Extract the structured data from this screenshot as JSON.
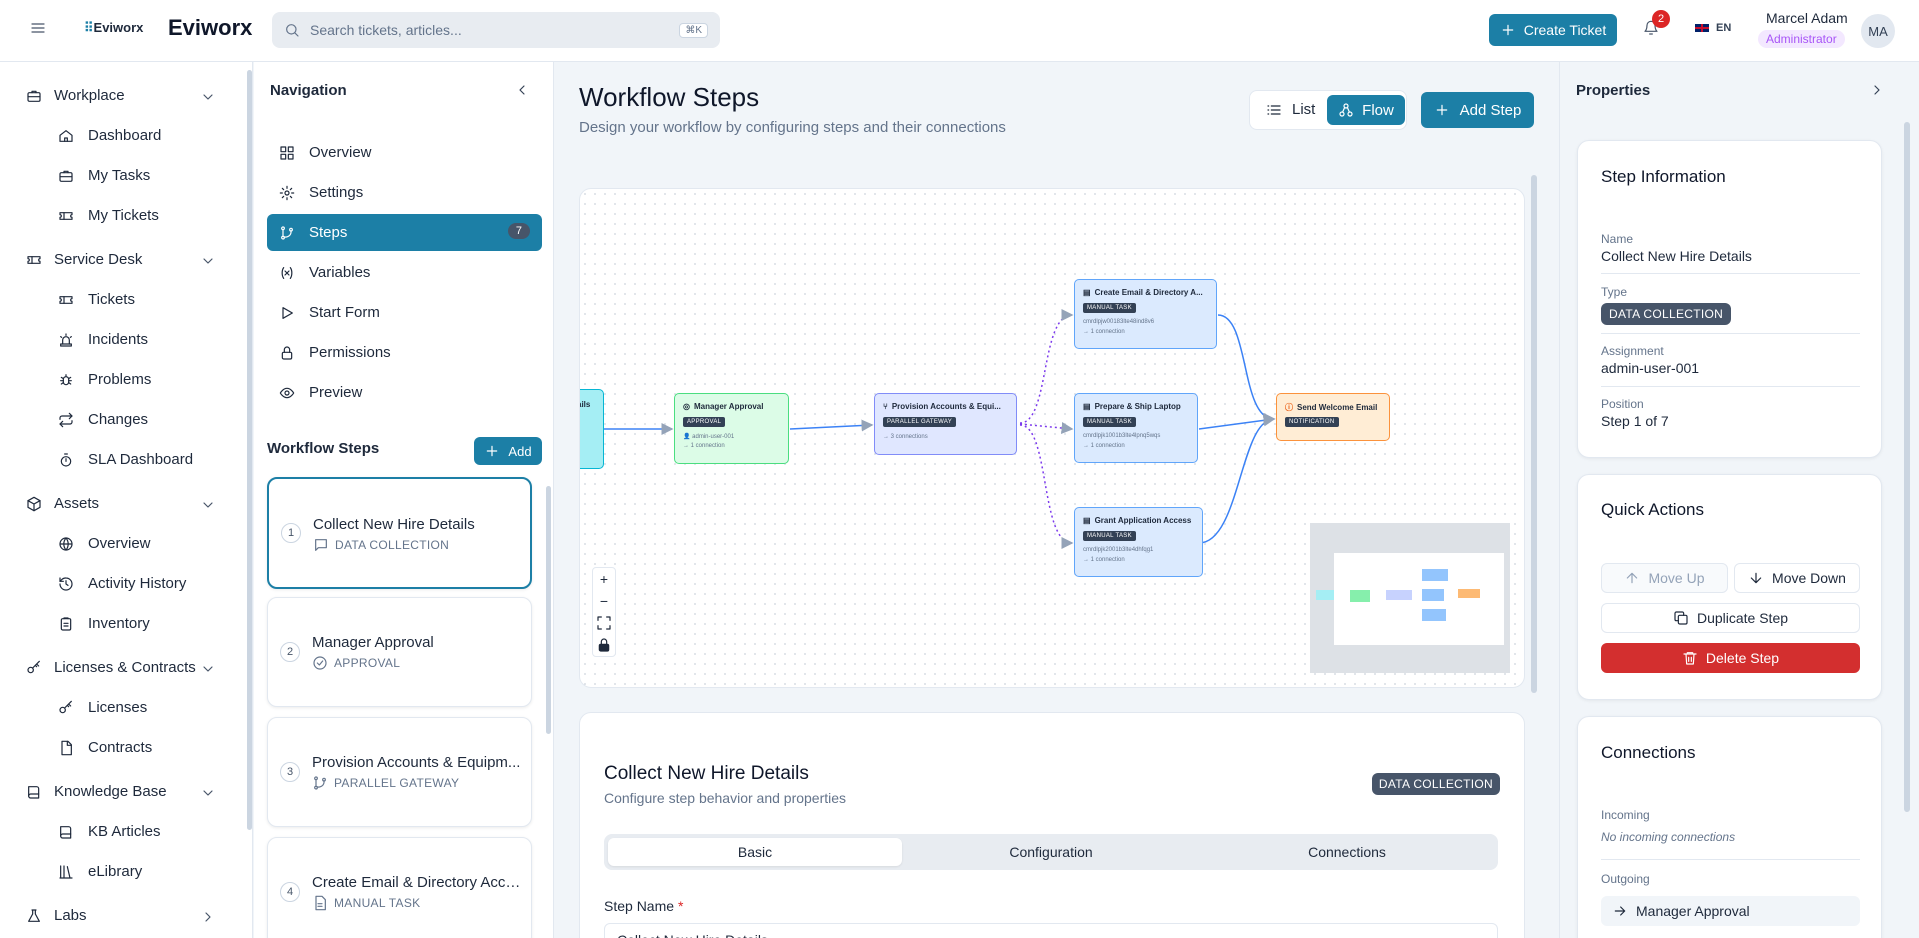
{
  "header": {
    "logo_text": "Eviworx",
    "brand": "Eviworx",
    "search_placeholder": "Search tickets, articles...",
    "search_shortcut": "⌘K",
    "create_ticket": "Create Ticket",
    "notification_count": "2",
    "language": "EN",
    "user_name": "Marcel Adam",
    "user_role": "Administrator",
    "avatar_initials": "MA"
  },
  "sidebar": {
    "sections": [
      {
        "label": "Workplace",
        "icon": "briefcase-icon",
        "items": [
          {
            "label": "Dashboard",
            "icon": "home-icon"
          },
          {
            "label": "My Tasks",
            "icon": "briefcase-icon"
          },
          {
            "label": "My Tickets",
            "icon": "ticket-icon"
          }
        ]
      },
      {
        "label": "Service Desk",
        "icon": "ticket-icon",
        "items": [
          {
            "label": "Tickets",
            "icon": "ticket-icon"
          },
          {
            "label": "Incidents",
            "icon": "siren-icon"
          },
          {
            "label": "Problems",
            "icon": "bug-icon"
          },
          {
            "label": "Changes",
            "icon": "repeat-icon"
          },
          {
            "label": "SLA Dashboard",
            "icon": "timer-icon"
          }
        ]
      },
      {
        "label": "Assets",
        "icon": "box-icon",
        "items": [
          {
            "label": "Overview",
            "icon": "globe-icon"
          },
          {
            "label": "Activity History",
            "icon": "history-icon"
          },
          {
            "label": "Inventory",
            "icon": "clipboard-icon"
          }
        ]
      },
      {
        "label": "Licenses & Contracts",
        "icon": "key-icon",
        "items": [
          {
            "label": "Licenses",
            "icon": "key-icon"
          },
          {
            "label": "Contracts",
            "icon": "file-icon"
          }
        ]
      },
      {
        "label": "Knowledge Base",
        "icon": "book-icon",
        "items": [
          {
            "label": "KB Articles",
            "icon": "book-icon"
          },
          {
            "label": "eLibrary",
            "icon": "library-icon"
          }
        ]
      },
      {
        "label": "Labs",
        "icon": "flask-icon",
        "items": []
      }
    ]
  },
  "nav_panel": {
    "title": "Navigation",
    "items": [
      {
        "label": "Overview",
        "icon": "grid-icon"
      },
      {
        "label": "Settings",
        "icon": "gear-icon"
      },
      {
        "label": "Steps",
        "icon": "git-branch-icon",
        "count": "7"
      },
      {
        "label": "Variables",
        "icon": "variable-icon"
      },
      {
        "label": "Start Form",
        "icon": "play-icon"
      },
      {
        "label": "Permissions",
        "icon": "lock-icon"
      },
      {
        "label": "Preview",
        "icon": "eye-icon"
      }
    ],
    "workflow_steps_title": "Workflow Steps",
    "add_label": "Add",
    "steps": [
      {
        "num": "1",
        "title": "Collect New Hire Details",
        "type": "DATA COLLECTION"
      },
      {
        "num": "2",
        "title": "Manager Approval",
        "type": "APPROVAL"
      },
      {
        "num": "3",
        "title": "Provision Accounts & Equipm...",
        "type": "PARALLEL GATEWAY"
      },
      {
        "num": "4",
        "title": "Create Email & Directory Acco...",
        "type": "MANUAL TASK"
      }
    ]
  },
  "main": {
    "title": "Workflow Steps",
    "subtitle": "Design your workflow by configuring steps and their connections",
    "view_list": "List",
    "view_flow": "Flow",
    "add_step": "Add Step",
    "flow": {
      "nodes": [
        {
          "id": "n0",
          "title": "ails",
          "badge": "",
          "info": "",
          "conn": ""
        },
        {
          "id": "n1",
          "title": "Manager Approval",
          "badge": "APPROVAL",
          "info": "admin-user-001",
          "conn": "→ 1 connection"
        },
        {
          "id": "n2",
          "title": "Provision Accounts & Equi...",
          "badge": "PARALLEL GATEWAY",
          "info": "",
          "conn": "→ 3 connections"
        },
        {
          "id": "n3",
          "title": "Create Email & Directory A...",
          "badge": "MANUAL TASK",
          "info": "cmrdlpjw00183lte48ind8v6",
          "conn": "→ 1 connection"
        },
        {
          "id": "n4",
          "title": "Prepare & Ship Laptop",
          "badge": "MANUAL TASK",
          "info": "cmrdlpjk1001b3lte4lpnq5wqs",
          "conn": "→ 1 connection"
        },
        {
          "id": "n5",
          "title": "Grant Application Access",
          "badge": "MANUAL TASK",
          "info": "cmrdlpjk2001b3lte4dhfqg1",
          "conn": "→ 1 connection"
        },
        {
          "id": "n6",
          "title": "Send Welcome Email",
          "badge": "NOTIFICATION",
          "info": "",
          "conn": ""
        }
      ],
      "colors": {
        "data_collection": "#a5eef4",
        "approval": "#dcfce7",
        "gateway": "#e0e7ff",
        "manual": "#dbeafe",
        "notification": "#ffedd5"
      }
    },
    "detail": {
      "title": "Collect New Hire Details",
      "subtitle": "Configure step behavior and properties",
      "badge": "DATA COLLECTION",
      "tabs": [
        "Basic",
        "Configuration",
        "Connections"
      ],
      "step_name_label": "Step Name",
      "step_name_value": "Collect New Hire Details"
    }
  },
  "properties": {
    "title": "Properties",
    "step_info": {
      "title": "Step Information",
      "name_label": "Name",
      "name_value": "Collect New Hire Details",
      "type_label": "Type",
      "type_value": "DATA COLLECTION",
      "assignment_label": "Assignment",
      "assignment_value": "admin-user-001",
      "position_label": "Position",
      "position_value": "Step 1 of 7"
    },
    "quick_actions": {
      "title": "Quick Actions",
      "move_up": "Move Up",
      "move_down": "Move Down",
      "duplicate": "Duplicate Step",
      "delete": "Delete Step"
    },
    "connections": {
      "title": "Connections",
      "incoming_label": "Incoming",
      "incoming_value": "No incoming connections",
      "outgoing_label": "Outgoing",
      "outgoing_value": "Manager Approval"
    }
  }
}
